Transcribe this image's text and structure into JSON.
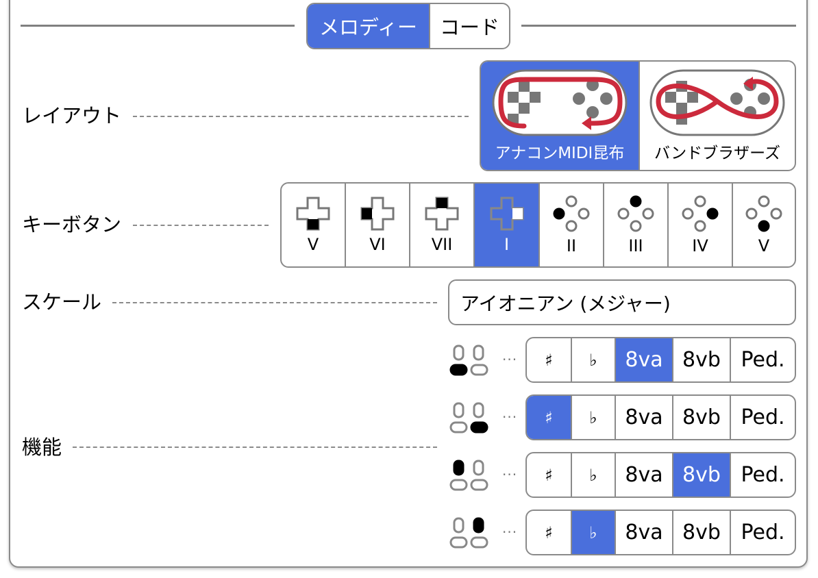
{
  "tabs": {
    "melody": "メロディー",
    "chord": "コード",
    "selected": "melody"
  },
  "rows": {
    "layout": "レイアウト",
    "keybutton": "キーボタン",
    "scale": "スケール",
    "function": "機能"
  },
  "layout_options": [
    {
      "label": "アナコンMIDI昆布",
      "selected": true
    },
    {
      "label": "バンドブラザーズ",
      "selected": false
    }
  ],
  "key_buttons": [
    {
      "label": "V",
      "icon": "dpad-down-icon",
      "selected": false
    },
    {
      "label": "VI",
      "icon": "dpad-left-icon",
      "selected": false
    },
    {
      "label": "VII",
      "icon": "dpad-up-icon",
      "selected": false
    },
    {
      "label": "I",
      "icon": "dpad-right-icon",
      "selected": true
    },
    {
      "label": "II",
      "icon": "face-left-icon",
      "selected": false
    },
    {
      "label": "III",
      "icon": "face-top-icon",
      "selected": false
    },
    {
      "label": "IV",
      "icon": "face-right-icon",
      "selected": false
    },
    {
      "label": "V",
      "icon": "face-bottom-icon",
      "selected": false
    }
  ],
  "scale": {
    "value": "アイオニアン (メジャー)"
  },
  "function_labels": [
    "♯",
    "♭",
    "8va",
    "8vb",
    "Ped."
  ],
  "function_rows": [
    {
      "icon": "shoulder-bottom-left-icon",
      "selected": "8va"
    },
    {
      "icon": "shoulder-bottom-right-icon",
      "selected": "♯"
    },
    {
      "icon": "shoulder-top-left-icon",
      "selected": "8vb"
    },
    {
      "icon": "shoulder-top-right-icon",
      "selected": "♭"
    }
  ],
  "separator": "···",
  "colors": {
    "accent": "#4a6fdc",
    "border": "#8a8a8a",
    "path": "#cc2a3c"
  }
}
